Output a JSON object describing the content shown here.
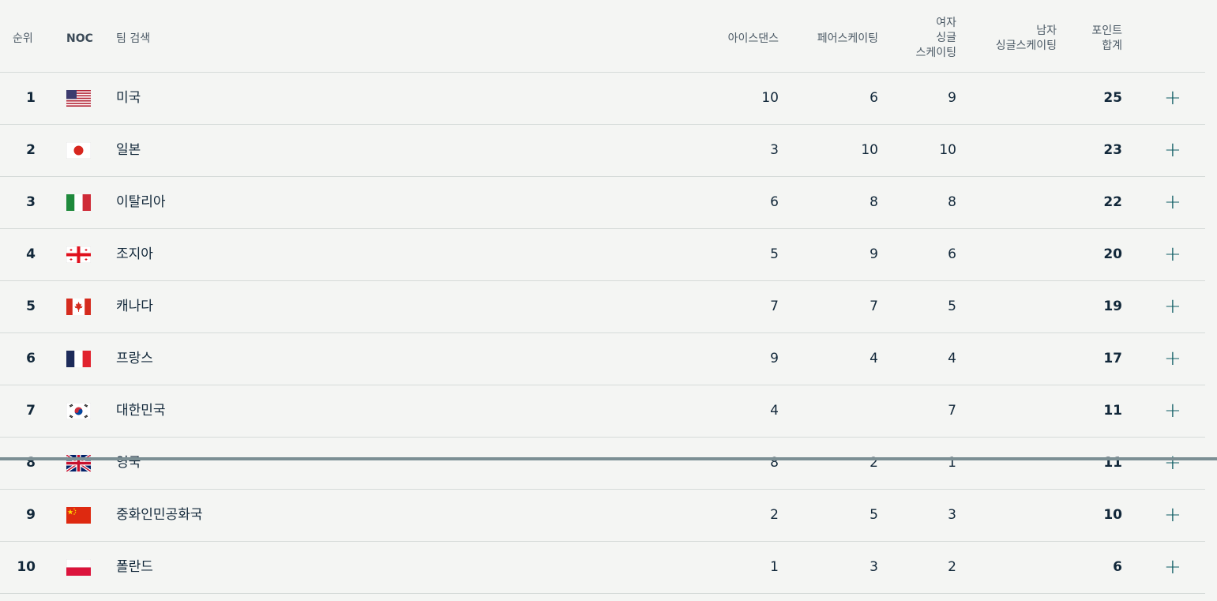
{
  "header": {
    "rank": "순위",
    "noc": "NOC",
    "team": "팀 검색",
    "ice_dance": "아이스댄스",
    "pair": "페어스케이팅",
    "women_l1": "여자",
    "women_l2": "싱글",
    "women_l3": "스케이팅",
    "men_l1": "남자",
    "men_l2": "싱글스케이팅",
    "total_l1": "포인트",
    "total_l2": "합계"
  },
  "rows": [
    {
      "rank": "1",
      "flag": "usa-flag-icon",
      "team": "미국",
      "ice": "10",
      "pair": "6",
      "women": "9",
      "men": "",
      "total": "25",
      "expand": "+"
    },
    {
      "rank": "2",
      "flag": "japan-flag-icon",
      "team": "일본",
      "ice": "3",
      "pair": "10",
      "women": "10",
      "men": "",
      "total": "23",
      "expand": "+"
    },
    {
      "rank": "3",
      "flag": "italy-flag-icon",
      "team": "이탈리아",
      "ice": "6",
      "pair": "8",
      "women": "8",
      "men": "",
      "total": "22",
      "expand": "+"
    },
    {
      "rank": "4",
      "flag": "georgia-flag-icon",
      "team": "조지아",
      "ice": "5",
      "pair": "9",
      "women": "6",
      "men": "",
      "total": "20",
      "expand": "+"
    },
    {
      "rank": "5",
      "flag": "canada-flag-icon",
      "team": "캐나다",
      "ice": "7",
      "pair": "7",
      "women": "5",
      "men": "",
      "total": "19",
      "expand": "+"
    },
    {
      "rank": "6",
      "flag": "france-flag-icon",
      "team": "프랑스",
      "ice": "9",
      "pair": "4",
      "women": "4",
      "men": "",
      "total": "17",
      "expand": "+"
    },
    {
      "rank": "7",
      "flag": "korea-flag-icon",
      "team": "대한민국",
      "ice": "4",
      "pair": "",
      "women": "7",
      "men": "",
      "total": "11",
      "expand": "+"
    },
    {
      "rank": "8",
      "flag": "uk-flag-icon",
      "team": "영국",
      "ice": "8",
      "pair": "2",
      "women": "1",
      "men": "",
      "total": "11",
      "expand": "+"
    },
    {
      "rank": "9",
      "flag": "china-flag-icon",
      "team": "중화인민공화국",
      "ice": "2",
      "pair": "5",
      "women": "3",
      "men": "",
      "total": "10",
      "expand": "+"
    },
    {
      "rank": "10",
      "flag": "poland-flag-icon",
      "team": "폴란드",
      "ice": "1",
      "pair": "3",
      "women": "2",
      "men": "",
      "total": "6",
      "expand": "+"
    }
  ]
}
